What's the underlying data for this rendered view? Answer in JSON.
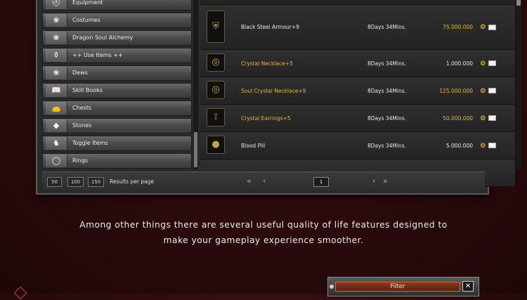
{
  "sidebar": {
    "categories": [
      {
        "label": "Equipment",
        "icon": "helmet-icon",
        "glyph": "⛑"
      },
      {
        "label": "Costumes",
        "icon": "lotus-icon",
        "glyph": "❀"
      },
      {
        "label": "Dragon Soul Alchemy",
        "icon": "lotus-icon",
        "glyph": "❀"
      },
      {
        "label": "++ Use Items ++",
        "icon": "potion-icon",
        "glyph": "⚱"
      },
      {
        "label": "Dews",
        "icon": "lotus-icon",
        "glyph": "❀"
      },
      {
        "label": "Skill Books",
        "icon": "book-icon",
        "glyph": "📖"
      },
      {
        "label": "Chests",
        "icon": "bag-icon",
        "glyph": "👝"
      },
      {
        "label": "Stones",
        "icon": "stone-icon",
        "glyph": "◆"
      },
      {
        "label": "Toggle Items",
        "icon": "horse-icon",
        "glyph": "♞"
      },
      {
        "label": "Rings",
        "icon": "ring-icon",
        "glyph": "◯"
      }
    ]
  },
  "items": [
    {
      "name": "Black Steel Armour+9",
      "time": "8Days 34Mins.",
      "price": "75.000.000",
      "name_gold": false,
      "price_gold": true,
      "icon": "armour-icon",
      "glyph": "⛨"
    },
    {
      "name": "Crystal Necklace+5",
      "time": "8Days 34Mins.",
      "price": "1.000.000",
      "name_gold": true,
      "price_gold": false,
      "icon": "necklace-icon",
      "glyph": "◎"
    },
    {
      "name": "Soul Crystal Necklace+9",
      "time": "8Days 34Mins.",
      "price": "125.000.000",
      "name_gold": true,
      "price_gold": true,
      "icon": "necklace-icon",
      "glyph": "◎"
    },
    {
      "name": "Crystal Earrings+5",
      "time": "8Days 34Mins.",
      "price": "50.000.000",
      "name_gold": true,
      "price_gold": true,
      "icon": "earrings-icon",
      "glyph": "⟟"
    },
    {
      "name": "Blood Pill",
      "time": "8Days 34Mins.",
      "price": "5.000.000",
      "name_gold": false,
      "price_gold": false,
      "icon": "pill-icon",
      "glyph": "●"
    }
  ],
  "pagination": {
    "per_page_options": [
      "50",
      "100",
      "150"
    ],
    "per_page_label": "Results per page",
    "current_page": "1",
    "first": "«",
    "prev": "‹",
    "next": "›",
    "last": "»"
  },
  "caption": {
    "line1": "Among other things there are several useful quality of life features designed to",
    "line2": "make your gameplay experience smoother."
  },
  "filter": {
    "label": "Filter",
    "close": "✕"
  },
  "colors": {
    "gold": "#e7b43a",
    "background": "#2a0a0c"
  }
}
